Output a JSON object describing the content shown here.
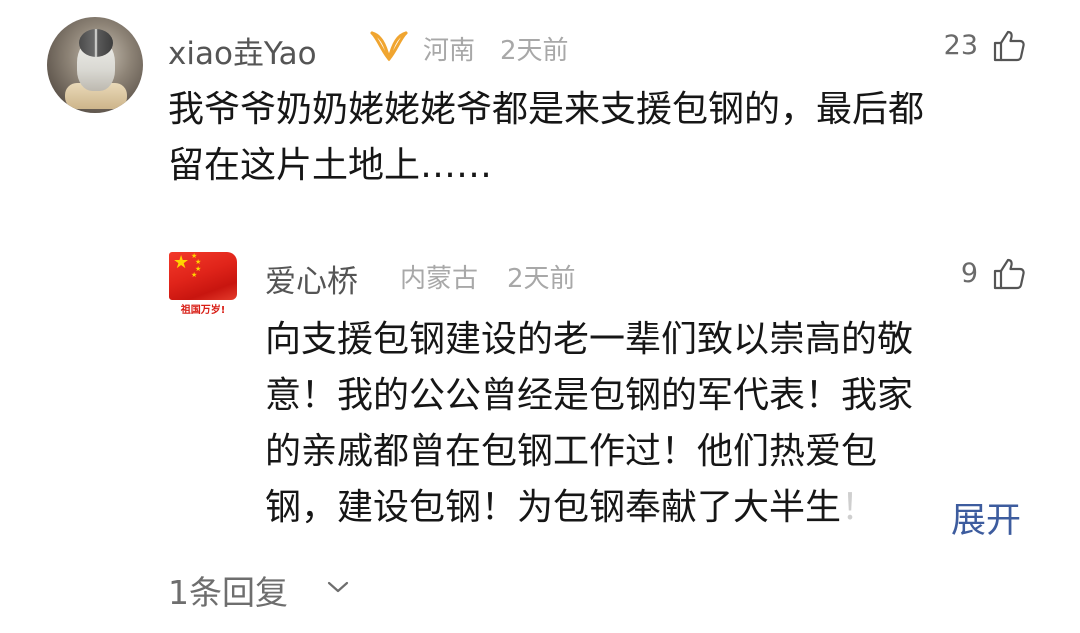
{
  "comment": {
    "username": "xiao垚Yao",
    "badge_icon": "vip-badge-icon",
    "location": "河南",
    "time": "2天前",
    "likes": "23",
    "lines": [
      "我爷爷奶奶姥姥姥爷都是来支援包钢的，最后都",
      "留在这片土地上……"
    ]
  },
  "reply": {
    "username": "爱心桥",
    "location": "内蒙古",
    "time": "2天前",
    "likes": "9",
    "avatar_caption": "祖国万岁!",
    "lines": [
      "向支援包钢建设的老一辈们致以崇高的敬",
      "意！我的公公曾经是包钢的军代表！我家",
      "的亲戚都曾在包钢工作过！他们热爱包",
      "钢，建设包钢！为包钢奉献了大半生"
    ],
    "truncated_tail": "！",
    "expand_label": "展开"
  },
  "replies_label": "1条回复",
  "colors": {
    "accent_link": "#3d5c9e",
    "badge": "#f0a530",
    "flag_red": "#e0241a",
    "star": "#ffd400"
  }
}
